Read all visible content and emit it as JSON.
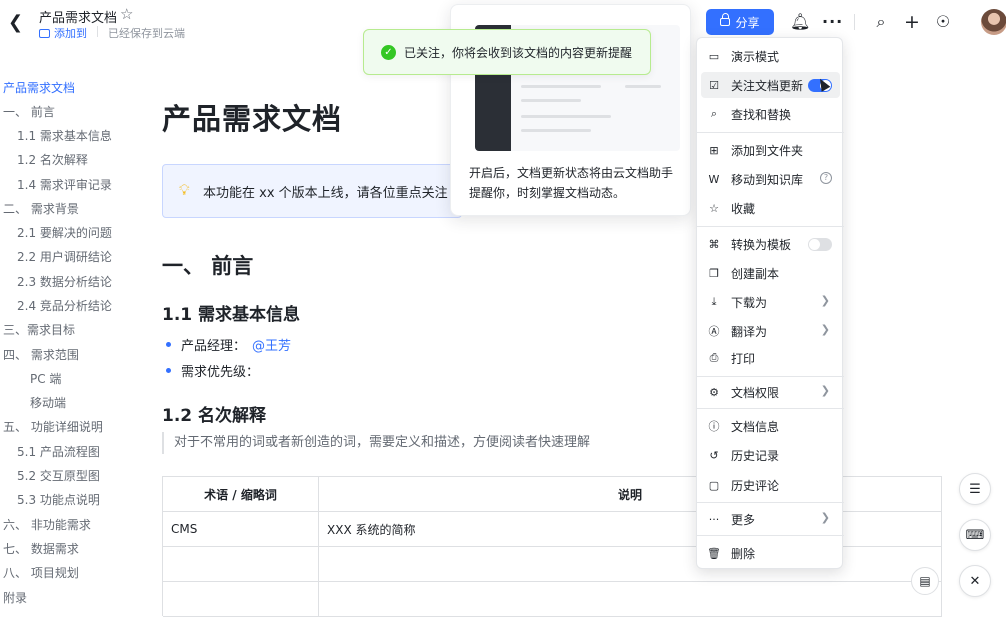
{
  "header": {
    "doc_title": "产品需求文档",
    "add_to": "添加到",
    "saved_status": "已经保存到云端",
    "share_label": "分享"
  },
  "outline": [
    {
      "label": "产品需求文档",
      "active": true
    },
    {
      "label": "一、 前言"
    },
    {
      "label": "1.1 需求基本信息"
    },
    {
      "label": "1.2 名次解释"
    },
    {
      "label": "1.4 需求评审记录"
    },
    {
      "label": "二、 需求背景"
    },
    {
      "label": "2.1 要解决的问题"
    },
    {
      "label": "2.2 用户调研结论"
    },
    {
      "label": "2.3 数据分析结论"
    },
    {
      "label": "2.4 竞品分析结论"
    },
    {
      "label": "三、需求目标"
    },
    {
      "label": "四、 需求范围"
    },
    {
      "label": "PC 端"
    },
    {
      "label": "移动端"
    },
    {
      "label": "五、 功能详细说明"
    },
    {
      "label": "5.1 产品流程图"
    },
    {
      "label": "5.2 交互原型图"
    },
    {
      "label": "5.3 功能点说明"
    },
    {
      "label": "六、 非功能需求"
    },
    {
      "label": "七、 数据需求"
    },
    {
      "label": "八、 项目规划"
    },
    {
      "label": "附录"
    }
  ],
  "doc": {
    "title": "产品需求文档",
    "callout": "本功能在 xx 个版本上线，请各位重点关注",
    "h1": "一、 前言",
    "h2_basic": "1.1 需求基本信息",
    "pm_label": "产品经理：",
    "pm_mention": "@王芳",
    "priority_label": "需求优先级：",
    "h2_terms": "1.2 名次解释",
    "quote": "对于不常用的词或者新创造的词，需要定义和描述，方便阅读者快速理解",
    "table": {
      "headers": [
        "术语 / 缩略词",
        "说明"
      ],
      "rows": [
        [
          "CMS",
          "XXX 系统的简称"
        ],
        [
          "",
          ""
        ],
        [
          "",
          ""
        ]
      ]
    }
  },
  "tooltip": {
    "text": "开启后，文档更新状态将由云文档助手提醒你，时刻掌握文档动态。"
  },
  "toast": {
    "text": "已关注，你将会收到该文档的内容更新提醒"
  },
  "menu": {
    "items": [
      {
        "label": "演示模式",
        "icon": "presentation-icon"
      },
      {
        "label": "关注文档更新",
        "icon": "follow-icon",
        "toggle": true
      },
      {
        "label": "查找和替换",
        "icon": "find-replace-icon"
      },
      {
        "label": "添加到文件夹",
        "icon": "add-folder-icon"
      },
      {
        "label": "移动到知识库",
        "icon": "wiki-icon",
        "help": true
      },
      {
        "label": "收藏",
        "icon": "star-icon"
      },
      {
        "label": "转换为模板",
        "icon": "template-icon",
        "toggle": false
      },
      {
        "label": "创建副本",
        "icon": "copy-icon"
      },
      {
        "label": "下载为",
        "icon": "download-icon",
        "submenu": true
      },
      {
        "label": "翻译为",
        "icon": "translate-icon",
        "submenu": true
      },
      {
        "label": "打印",
        "icon": "print-icon"
      },
      {
        "label": "文档权限",
        "icon": "settings-icon",
        "submenu": true
      },
      {
        "label": "文档信息",
        "icon": "info-icon"
      },
      {
        "label": "历史记录",
        "icon": "history-icon"
      },
      {
        "label": "历史评论",
        "icon": "comment-history-icon"
      },
      {
        "label": "更多",
        "icon": "more-icon",
        "submenu": true
      },
      {
        "label": "删除",
        "icon": "delete-icon"
      }
    ]
  }
}
